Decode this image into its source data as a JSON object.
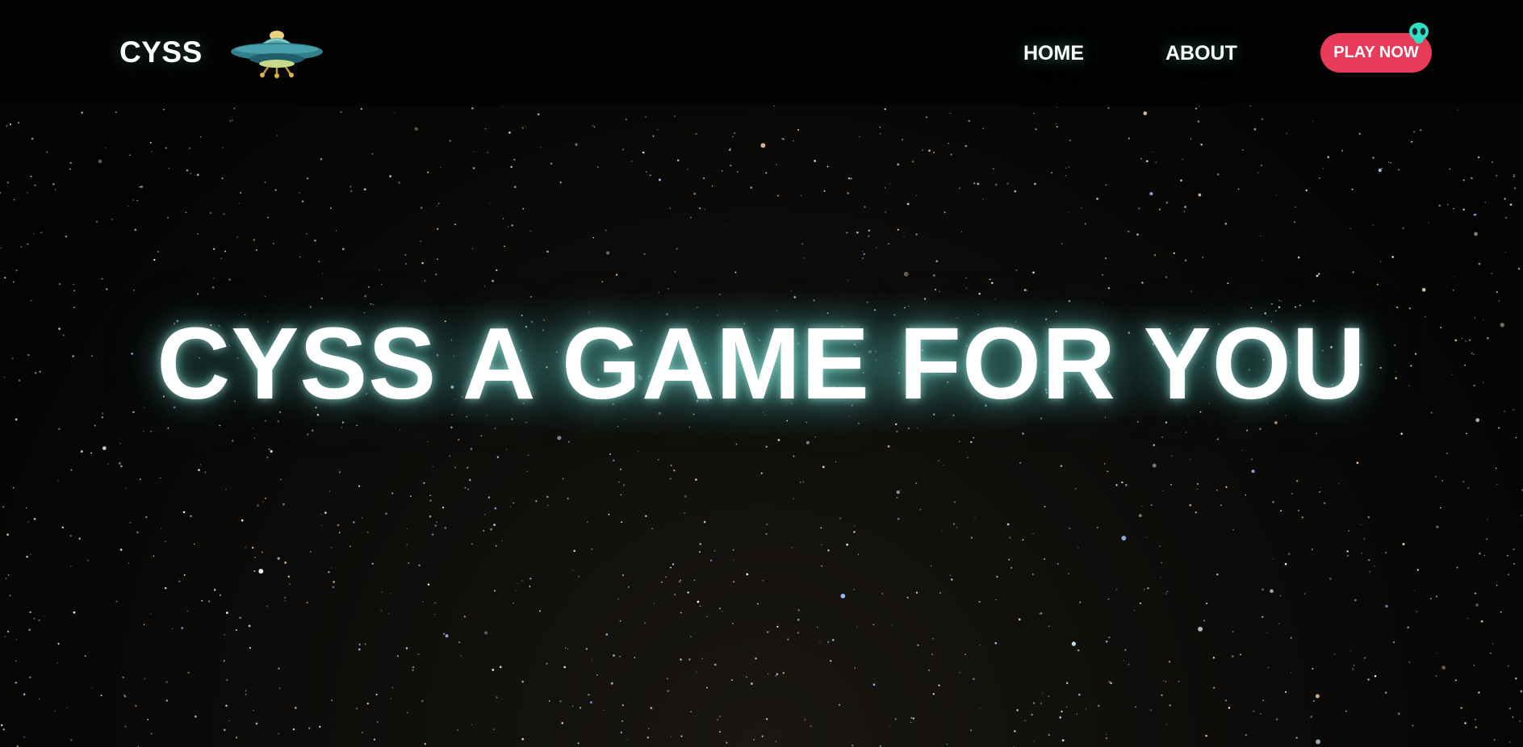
{
  "header": {
    "brand": "CYSS",
    "logo_icon": "ufo-icon",
    "nav": {
      "home_label": "HOME",
      "about_label": "ABOUT"
    },
    "play_button_label": "PLAY NOW",
    "cursor_icon": "alien-cursor-icon"
  },
  "hero": {
    "title": "CYSS A GAME FOR YOU",
    "background": "starfield-image"
  },
  "colors": {
    "accent": "#e83a59",
    "glow": "#5fbfb3",
    "header_bg": "#030303",
    "text": "#ffffff"
  }
}
